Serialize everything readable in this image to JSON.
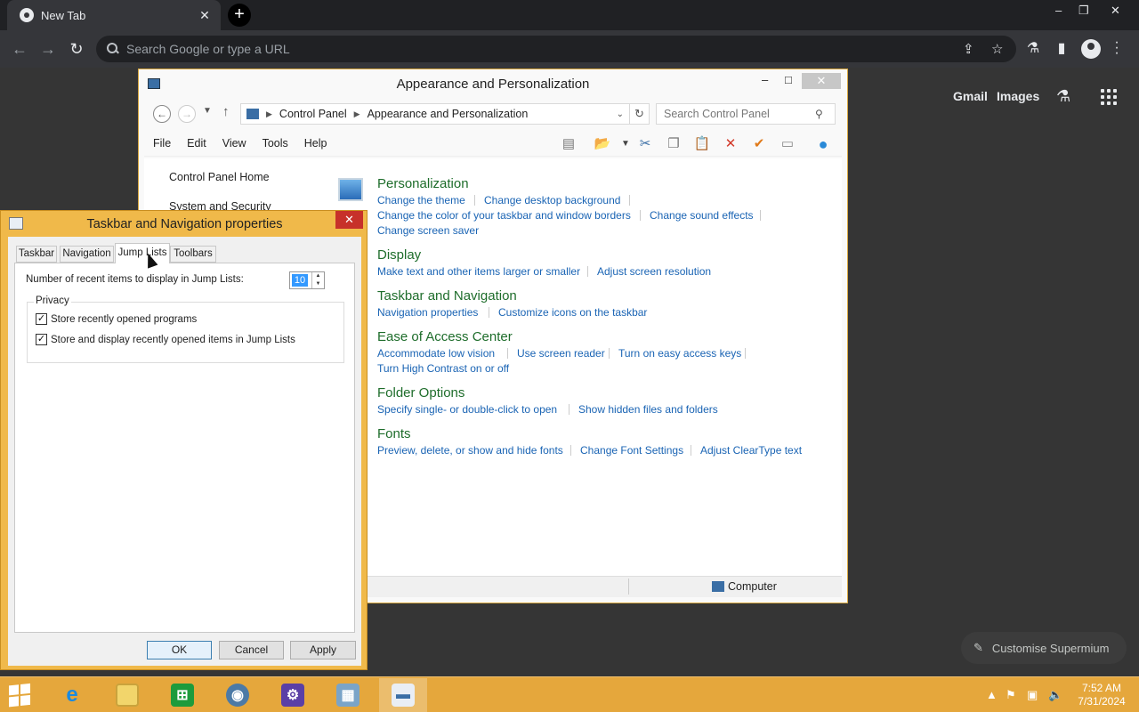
{
  "browser": {
    "tab_title": "New Tab",
    "tab_close": "✕",
    "new_tab": "+",
    "omnibox_placeholder": "Search Google or type a URL",
    "ntp_links": [
      "Gmail",
      "Images"
    ],
    "customise_label": "Customise Supermium",
    "window_controls": [
      "–",
      "❐",
      "✕"
    ]
  },
  "control_panel": {
    "title": "Appearance and Personalization",
    "breadcrumb": [
      "Control Panel",
      "Appearance and Personalization"
    ],
    "search_placeholder": "Search Control Panel",
    "menu": [
      "File",
      "Edit",
      "View",
      "Tools",
      "Help"
    ],
    "sidebar": [
      "Control Panel Home",
      "System and Security"
    ],
    "categories": [
      {
        "title": "Personalization",
        "links": [
          "Change the theme",
          "Change desktop background",
          "Change the color of your taskbar and window borders",
          "Change sound effects",
          "Change screen saver"
        ]
      },
      {
        "title": "Display",
        "links": [
          "Make text and other items larger or smaller",
          "Adjust screen resolution"
        ]
      },
      {
        "title": "Taskbar and Navigation",
        "links": [
          "Navigation properties",
          "Customize icons on the taskbar"
        ]
      },
      {
        "title": "Ease of Access Center",
        "links": [
          "Accommodate low vision",
          "Use screen reader",
          "Turn on easy access keys",
          "Turn High Contrast on or off"
        ]
      },
      {
        "title": "Folder Options",
        "links": [
          "Specify single- or double-click to open",
          "Show hidden files and folders"
        ]
      },
      {
        "title": "Fonts",
        "links": [
          "Preview, delete, or show and hide fonts",
          "Change Font Settings",
          "Adjust ClearType text"
        ]
      }
    ],
    "status_location": "Computer"
  },
  "dialog": {
    "title": "Taskbar and Navigation properties",
    "tabs": [
      "Taskbar",
      "Navigation",
      "Jump Lists",
      "Toolbars"
    ],
    "active_tab": "Jump Lists",
    "recent_items_label": "Number of recent items to display in Jump Lists:",
    "recent_items_value": "10",
    "privacy_legend": "Privacy",
    "checkboxes": [
      {
        "label": "Store recently opened programs",
        "checked": true
      },
      {
        "label": "Store and display recently opened items in Jump Lists",
        "checked": true
      }
    ],
    "buttons": {
      "ok": "OK",
      "cancel": "Cancel",
      "apply": "Apply"
    }
  },
  "taskbar": {
    "time": "7:52 AM",
    "date": "7/31/2024",
    "apps": [
      "internet-explorer-icon",
      "file-explorer-icon",
      "store-icon",
      "browser-icon",
      "settings-icon",
      "control-panel-icon",
      "taskbar-properties-icon"
    ]
  }
}
